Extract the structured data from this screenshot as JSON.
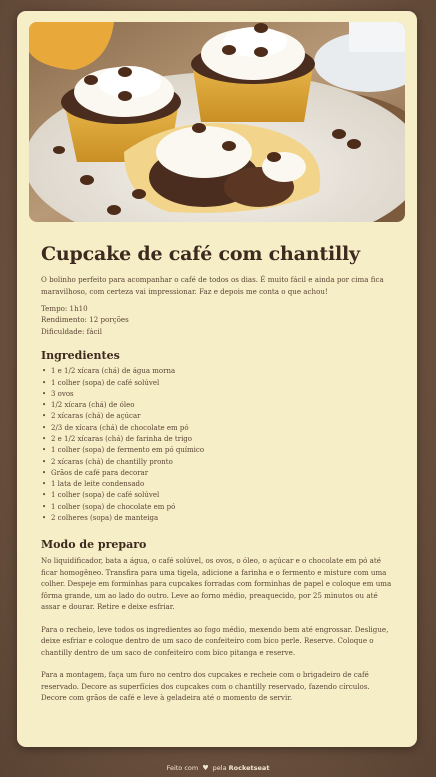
{
  "hero": {
    "image": "cupcakes-photo"
  },
  "recipe": {
    "title": "Cupcake de café com chantilly",
    "intro": "O bolinho perfeito para acompanhar o café de todos os dias. É muito fácil e ainda por cima fica maravilhoso, com certeza vai impressionar. Faz e depois me conta o que achou!",
    "time": "Tempo: 1h10",
    "yield": "Rendimento: 12 porções",
    "difficulty": "Dificuldade: fácil"
  },
  "ingredients": {
    "heading": "Ingredientes",
    "items": [
      "1 e 1/2 xícara (chá) de água morna",
      "1 colher (sopa) de café solúvel",
      "3 ovos",
      "1/2 xícara (chá) de óleo",
      "2 xícaras (chá) de açúcar",
      "2/3 de xícara (chá) de chocolate em pó",
      "2 e 1/2 xícaras (chá) de farinha de trigo",
      "1 colher (sopa) de fermento em pó químico",
      "2 xícaras (chá) de chantilly pronto",
      "Grãos de café para decorar",
      "1 lata de leite condensado",
      "1 colher (sopa) de café solúvel",
      "1 colher (sopa) de chocolate em pó",
      "2 colheres (sopa) de manteiga"
    ]
  },
  "preparation": {
    "heading": "Modo de preparo",
    "paragraphs": [
      "No liquidificador, bata a água, o café solúvel, os ovos, o óleo, o açúcar e o chocolate em pó até ficar homogêneo. Transfira para uma tigela, adicione a farinha e o fermento e misture com uma colher. Despeje em forminhas para cupcakes forradas com forminhas de papel e coloque em uma fôrma grande, um ao lado do outro. Leve ao forno médio, preaquecido, por 25 minutos ou até assar e dourar. Retire e deixe esfriar.",
      "Para o recheio, leve todos os ingredientes ao fogo médio, mexendo bem até engrossar. Desligue, deixe esfriar e coloque dentro de um saco de confeiteiro com bico perle. Reserve. Coloque o chantilly dentro de um saco de confeiteiro com bico pitanga e reserve.",
      "Para a montagem, faça um furo no centro dos cupcakes e recheie com o brigadeiro de café reservado. Decore as superfícies dos cupcakes com o chantilly reservado, fazendo círculos. Decore com grãos de café e leve à geladeira até o momento de servir."
    ]
  },
  "footer": {
    "prefix": "Feito com",
    "icon": "heart-icon",
    "suffix": "pela",
    "brand": "Rocketseat"
  }
}
